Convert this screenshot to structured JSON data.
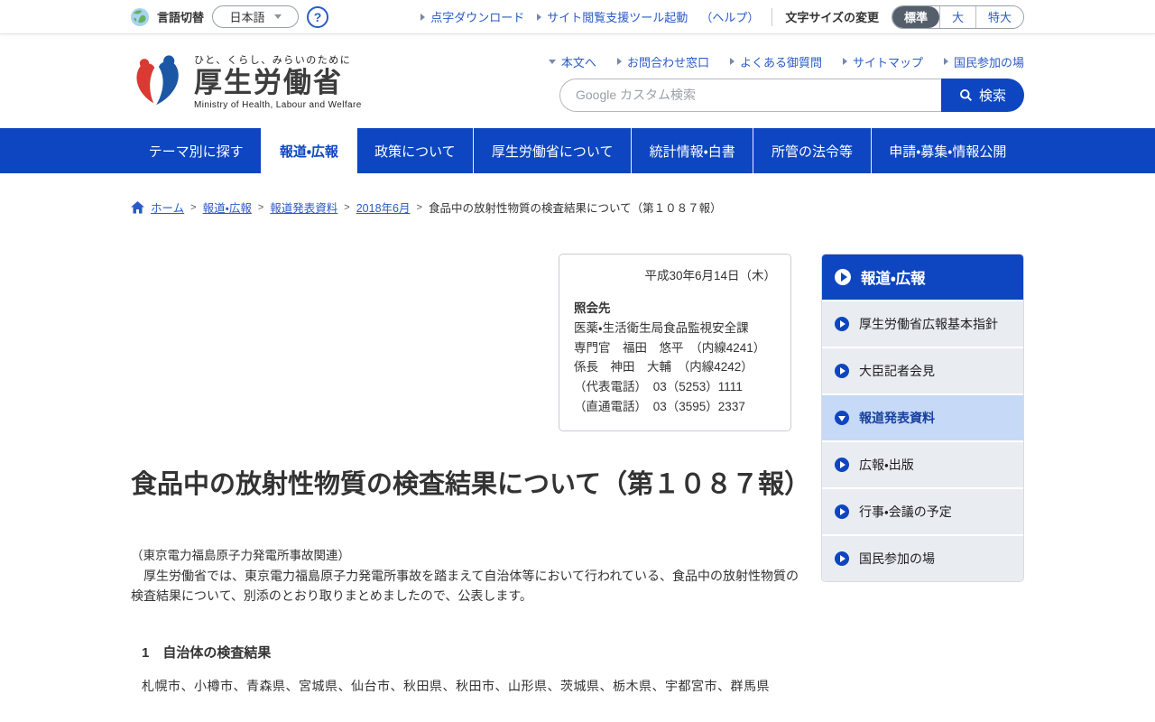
{
  "colors": {
    "primary_blue": "#0d46c0",
    "link_blue": "#2a5bc7",
    "sidebar_item_bg": "#e9edf2",
    "sidebar_active_bg": "#c6d9f7",
    "fontsize_active_bg": "#555f6b",
    "text_dark": "#333333"
  },
  "utility_bar": {
    "language": {
      "label": "言語切替",
      "value": "日本語"
    },
    "help_icon": "?",
    "links": [
      {
        "label": "点字ダウンロード"
      },
      {
        "label": "サイト閲覧支援ツール起動"
      }
    ],
    "help_suffix": "（ヘルプ）",
    "font_size": {
      "label": "文字サイズの変更",
      "options": [
        {
          "label": "標準",
          "active": true
        },
        {
          "label": "大",
          "active": false
        },
        {
          "label": "特大",
          "active": false
        }
      ]
    }
  },
  "header": {
    "tagline": "ひと、くらし、みらいのために",
    "site_name": "厚生労働省",
    "site_name_en": "Ministry of Health, Labour and Welfare",
    "quick_links": [
      {
        "label": "本文へ"
      },
      {
        "label": "お問合わせ窓口"
      },
      {
        "label": "よくある御質問"
      },
      {
        "label": "サイトマップ"
      },
      {
        "label": "国民参加の場"
      }
    ],
    "search": {
      "placeholder": "Google カスタム検索",
      "button_label": "検索"
    }
  },
  "nav": {
    "items": [
      {
        "label": "テーマ別に探す",
        "active": false
      },
      {
        "label": "報道・広報",
        "active": true
      },
      {
        "label": "政策について",
        "active": false
      },
      {
        "label": "厚生労働省について",
        "active": false
      },
      {
        "label": "統計情報・白書",
        "active": false
      },
      {
        "label": "所管の法令等",
        "active": false
      },
      {
        "label": "申請・募集・情報公開",
        "active": false
      }
    ]
  },
  "breadcrumb": {
    "links": [
      {
        "label": "ホーム"
      },
      {
        "label": "報道・広報"
      },
      {
        "label": "報道発表資料"
      },
      {
        "label": "2018年6月"
      }
    ],
    "current": "食品中の放射性物質の検査結果について（第１０８７報）"
  },
  "contact_box": {
    "date": "平成30年6月14日（木）",
    "heading": "照会先",
    "lines": [
      "医薬・生活衛生局食品監視安全課",
      "専門官　福田　悠平　（内線4241）",
      "係長　神田　大輔　（内線4242）",
      "（代表電話）　03（5253）1111",
      "（直通電話）　03（3595）2337"
    ]
  },
  "article": {
    "title": "食品中の放射性物質の検査結果について（第１０８７報）",
    "note": "（東京電力福島原子力発電所事故関連）",
    "paragraph": "　厚生労働省では、東京電力福島原子力発電所事故を踏まえて自治体等において行われている、食品中の放射性物質の検査結果について、別添のとおり取りまとめましたので、公表します。",
    "section1": {
      "heading": "1　自治体の検査結果",
      "partial_line": "札幌市、小樽市、青森県、宮城県、仙台市、秋田県、秋田市、山形県、茨城県、栃木県、宇都宮市、群馬県"
    }
  },
  "sidebar": {
    "header": "報道・広報",
    "items": [
      {
        "label": "厚生労働省広報基本指針",
        "active": false
      },
      {
        "label": "大臣記者会見",
        "active": false
      },
      {
        "label": "報道発表資料",
        "active": true
      },
      {
        "label": "広報・出版",
        "active": false
      },
      {
        "label": "行事・会議の予定",
        "active": false
      },
      {
        "label": "国民参加の場",
        "active": false
      }
    ]
  }
}
